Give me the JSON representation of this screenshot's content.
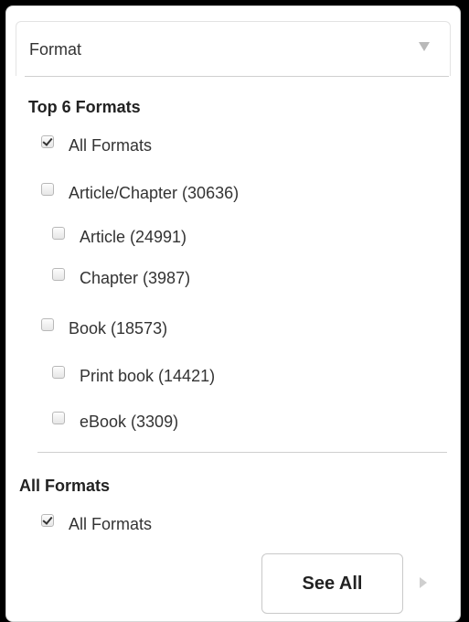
{
  "header": {
    "title": "Format",
    "toggle_icon": "triangle-down-icon"
  },
  "top_section": {
    "title": "Top 6 Formats",
    "items": [
      {
        "label": "All Formats",
        "checked": true
      },
      {
        "label": "Article/Chapter (30636)",
        "checked": false
      },
      {
        "label": "Article (24991)",
        "checked": false
      },
      {
        "label": "Chapter (3987)",
        "checked": false
      },
      {
        "label": "Book (18573)",
        "checked": false
      },
      {
        "label": "Print book (14421)",
        "checked": false
      },
      {
        "label": "eBook (3309)",
        "checked": false
      }
    ]
  },
  "all_section": {
    "title": "All Formats",
    "items": [
      {
        "label": "All Formats",
        "checked": true
      }
    ]
  },
  "see_all": {
    "label": "See All",
    "arrow_icon": "triangle-right-icon"
  }
}
